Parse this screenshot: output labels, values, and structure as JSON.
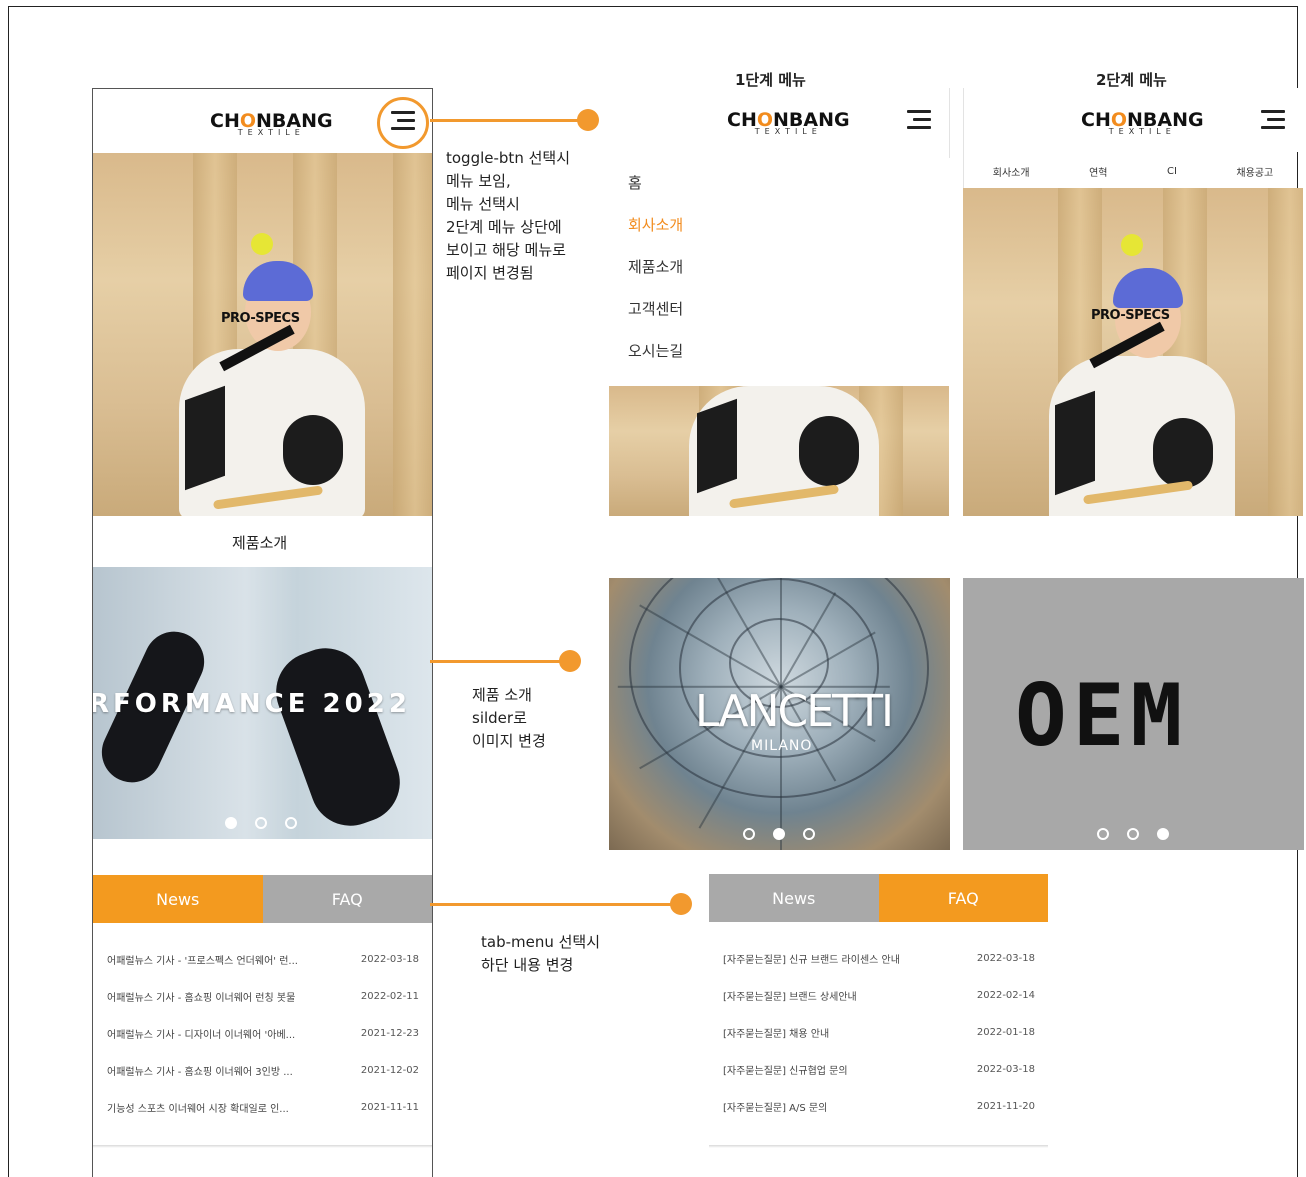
{
  "brand": {
    "logo_main": "CH",
    "logo_o": "O",
    "logo_rest": "NBANG",
    "logo_sub": "TEXTILE",
    "accent": "#f39a1f"
  },
  "labels": {
    "menu1": "1단계 메뉴",
    "menu2": "2단계 메뉴"
  },
  "annotations": {
    "toggle": [
      "toggle-btn 선택시",
      "메뉴 보임,",
      "메뉴 선택시",
      "2단계 메뉴 상단에",
      "보이고 해당 메뉴로",
      "페이지 변경됨"
    ],
    "slider": [
      "제품 소개",
      "silder로",
      "이미지 변경"
    ],
    "tab": [
      "tab-menu 선택시",
      "하단 내용 변경"
    ]
  },
  "hero": {
    "brand_text": "PRO-SPECS"
  },
  "section": {
    "product_title": "제품소개"
  },
  "slides": {
    "performance_text": "RFORMANCE 2022",
    "lancetti_text": "LANCETTI",
    "milano_text": "MILANO",
    "oem_text": "OEM"
  },
  "menu": {
    "items": [
      "홈",
      "회사소개",
      "제품소개",
      "고객센터",
      "오시는길"
    ],
    "active_index": 1
  },
  "submenu": {
    "items": [
      "회사소개",
      "연혁",
      "CI",
      "채용공고"
    ]
  },
  "tabs": {
    "news": "News",
    "faq": "FAQ"
  },
  "news_list": [
    {
      "title": "어패럴뉴스 기사 - '프로스펙스 언더웨어' 런...",
      "date": "2022-03-18"
    },
    {
      "title": "어패럴뉴스 기사 - 홈쇼핑 이너웨어 런칭 봇물",
      "date": "2022-02-11"
    },
    {
      "title": "어패럴뉴스 기사 - 디자이너 이너웨어 '아베...",
      "date": "2021-12-23"
    },
    {
      "title": "어패럴뉴스 기사 - 홈쇼핑 이너웨어 3인방 ...",
      "date": "2021-12-02"
    },
    {
      "title": "기능성 스포츠 이너웨어 시장 확대일로 인...",
      "date": "2021-11-11"
    }
  ],
  "faq_list": [
    {
      "title": "[자주묻는질문] 신규 브랜드 라이센스 안내",
      "date": "2022-03-18"
    },
    {
      "title": "[자주묻는질문] 브랜드 상세안내",
      "date": "2022-02-14"
    },
    {
      "title": "[자주묻는질문] 채용 안내",
      "date": "2022-01-18"
    },
    {
      "title": "[자주묻는질문] 신규협업 문의",
      "date": "2022-03-18"
    },
    {
      "title": "[자주묻는질문] A/S 문의",
      "date": "2021-11-20"
    }
  ]
}
